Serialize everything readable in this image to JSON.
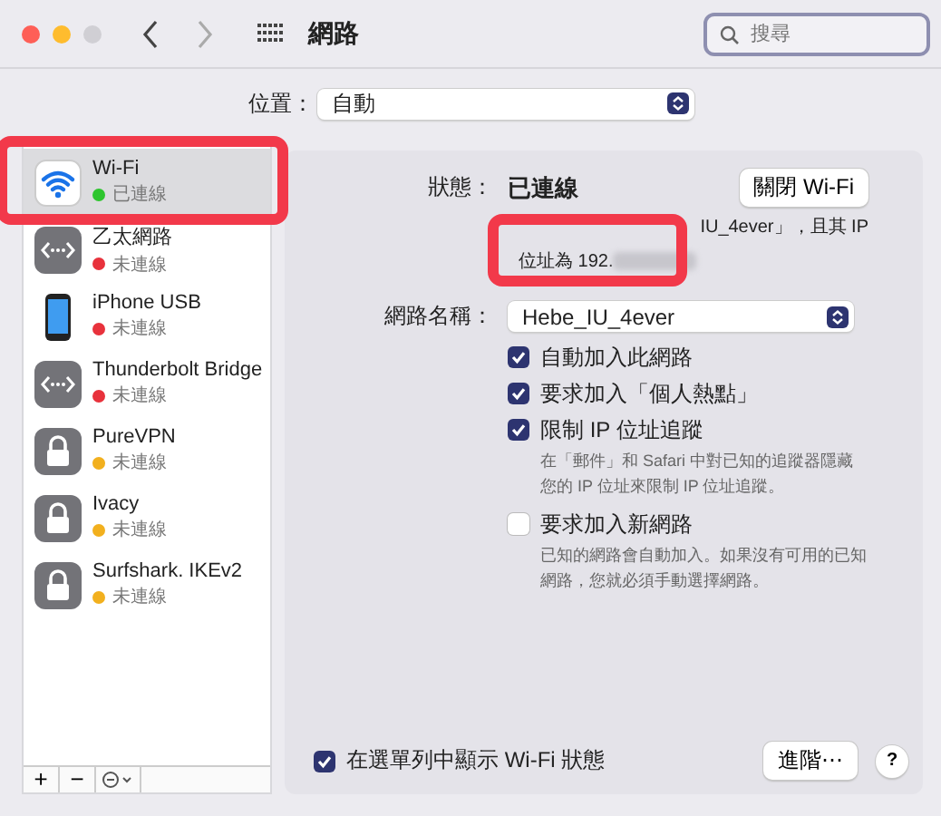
{
  "window": {
    "title": "網路",
    "search": {
      "placeholder": "搜尋"
    }
  },
  "location": {
    "label": "位置：",
    "value": "自動"
  },
  "sidebar": {
    "items": [
      {
        "kind": "wifi",
        "name": "Wi-Fi",
        "status": "已連線",
        "color": "#2ec52e",
        "selected": true,
        "highlighted": true
      },
      {
        "kind": "ethernet",
        "name": "乙太網路",
        "status": "未連線",
        "color": "#e8323c",
        "selected": false,
        "highlighted": false
      },
      {
        "kind": "phone",
        "name": "iPhone USB",
        "status": "未連線",
        "color": "#e8323c",
        "selected": false,
        "highlighted": false
      },
      {
        "kind": "ethernet",
        "name": "Thunderbolt Bridge",
        "status": "未連線",
        "color": "#e8323c",
        "selected": false,
        "highlighted": false
      },
      {
        "kind": "lock",
        "name": "PureVPN",
        "status": "未連線",
        "color": "#f2b01e",
        "selected": false,
        "highlighted": false
      },
      {
        "kind": "lock",
        "name": "Ivacy",
        "status": "未連線",
        "color": "#f2b01e",
        "selected": false,
        "highlighted": false
      },
      {
        "kind": "lock",
        "name": "Surfshark. IKEv2",
        "status": "未連線",
        "color": "#f2b01e",
        "selected": false,
        "highlighted": false
      }
    ],
    "buttons": [
      "+",
      "−"
    ]
  },
  "detail": {
    "status_label": "狀態：",
    "status_value": "已連線",
    "toggle_button": "關閉 Wi-Fi",
    "description_end": "IU_4ever」，且其 IP",
    "description_line_2": "位址為 192.",
    "ip_blurred": true,
    "highlighted": true,
    "network_label": "網路名稱：",
    "network_value": "Hebe_IU_4ever",
    "options": [
      {
        "label": "自動加入此網路",
        "checked": true
      },
      {
        "label": "要求加入「個人熱點」",
        "checked": true
      },
      {
        "label": "限制 IP 位址追蹤",
        "checked": true,
        "note": "在「郵件」和 Safari 中對已知的追蹤器隱藏您的 IP 位址來限制 IP 位址追蹤。"
      },
      {
        "label": "要求加入新網路",
        "checked": false,
        "note": "已知的網路會自動加入。如果沒有可用的已知網路，您就必須手動選擇網路。"
      }
    ],
    "menu_bar_option": {
      "label": "在選單列中顯示 Wi-Fi 狀態",
      "checked": true
    },
    "advanced_button": "進階⋯",
    "help_button": "?"
  }
}
